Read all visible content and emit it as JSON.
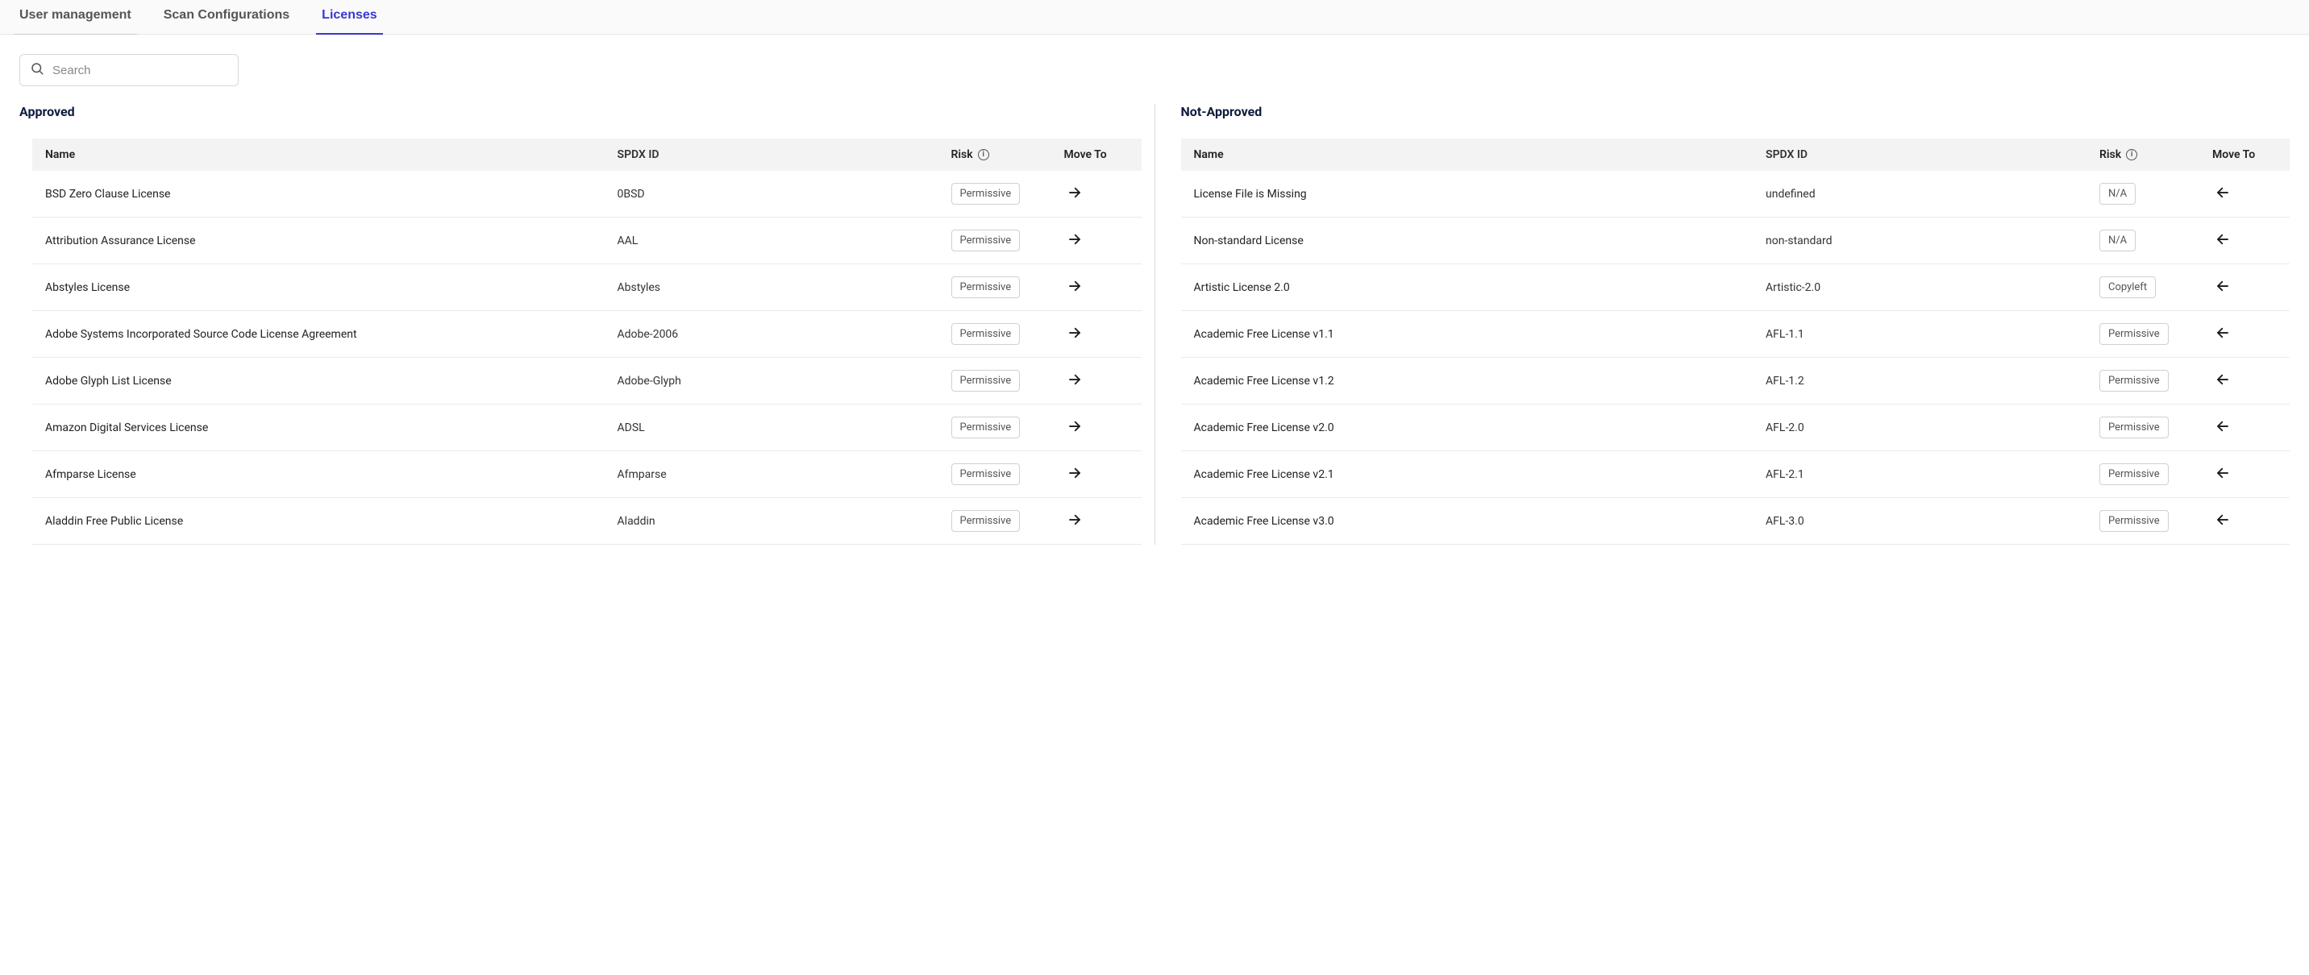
{
  "tabs": [
    {
      "label": "User management",
      "active": false,
      "underline": true
    },
    {
      "label": "Scan Configurations",
      "active": false,
      "underline": false
    },
    {
      "label": "Licenses",
      "active": true,
      "underline": false
    }
  ],
  "search": {
    "placeholder": "Search",
    "value": ""
  },
  "columns": {
    "name": "Name",
    "spdx": "SPDX ID",
    "risk": "Risk",
    "move": "Move To"
  },
  "approved": {
    "title": "Approved",
    "rows": [
      {
        "name": "BSD Zero Clause License",
        "spdx": "0BSD",
        "risk": "Permissive"
      },
      {
        "name": "Attribution Assurance License",
        "spdx": "AAL",
        "risk": "Permissive"
      },
      {
        "name": "Abstyles License",
        "spdx": "Abstyles",
        "risk": "Permissive"
      },
      {
        "name": "Adobe Systems Incorporated Source Code License Agreement",
        "spdx": "Adobe-2006",
        "risk": "Permissive"
      },
      {
        "name": "Adobe Glyph List License",
        "spdx": "Adobe-Glyph",
        "risk": "Permissive"
      },
      {
        "name": "Amazon Digital Services License",
        "spdx": "ADSL",
        "risk": "Permissive"
      },
      {
        "name": "Afmparse License",
        "spdx": "Afmparse",
        "risk": "Permissive"
      },
      {
        "name": "Aladdin Free Public License",
        "spdx": "Aladdin",
        "risk": "Permissive"
      }
    ]
  },
  "not_approved": {
    "title": "Not-Approved",
    "rows": [
      {
        "name": "License File is Missing",
        "spdx": "undefined",
        "risk": "N/A"
      },
      {
        "name": "Non-standard License",
        "spdx": "non-standard",
        "risk": "N/A"
      },
      {
        "name": "Artistic License 2.0",
        "spdx": "Artistic-2.0",
        "risk": "Copyleft"
      },
      {
        "name": "Academic Free License v1.1",
        "spdx": "AFL-1.1",
        "risk": "Permissive"
      },
      {
        "name": "Academic Free License v1.2",
        "spdx": "AFL-1.2",
        "risk": "Permissive"
      },
      {
        "name": "Academic Free License v2.0",
        "spdx": "AFL-2.0",
        "risk": "Permissive"
      },
      {
        "name": "Academic Free License v2.1",
        "spdx": "AFL-2.1",
        "risk": "Permissive"
      },
      {
        "name": "Academic Free License v3.0",
        "spdx": "AFL-3.0",
        "risk": "Permissive"
      }
    ]
  }
}
